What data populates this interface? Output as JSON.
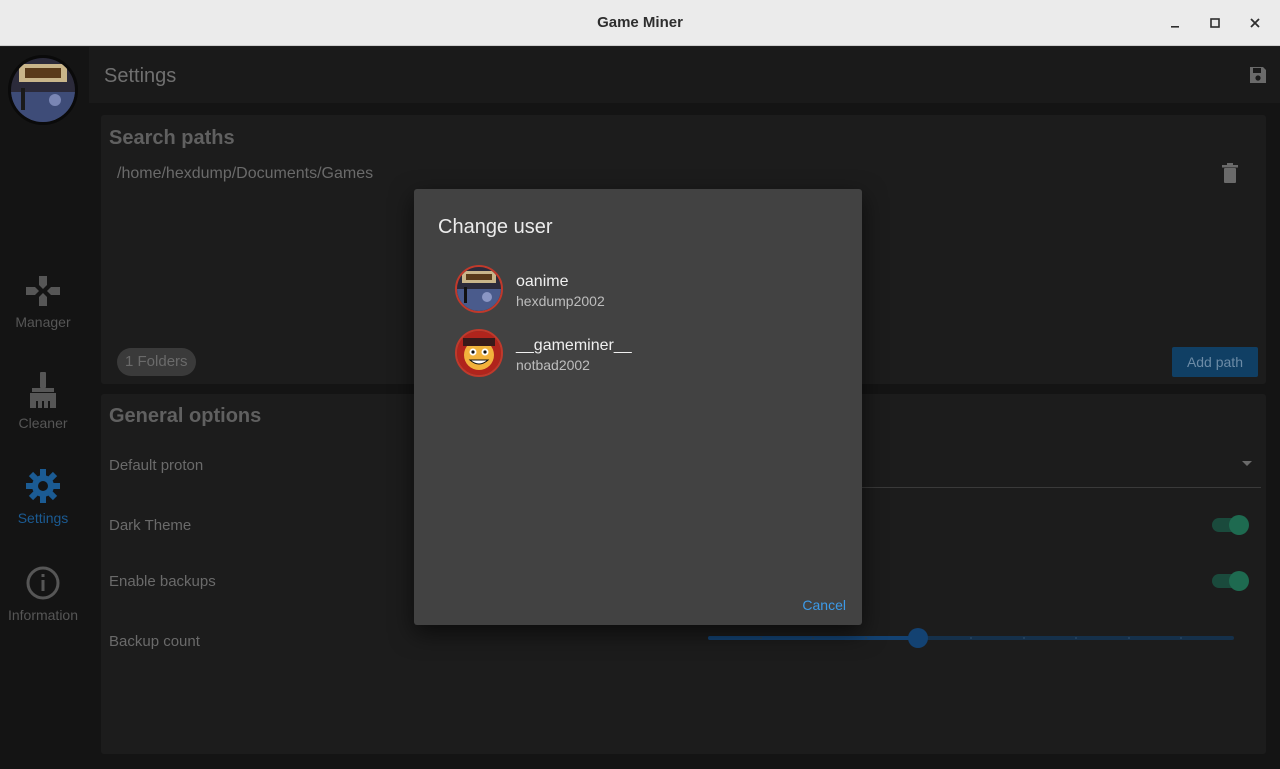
{
  "window": {
    "title": "Game Miner",
    "minimize_glyph": "–",
    "maximize_glyph": "□",
    "close_glyph": "✕"
  },
  "nav": {
    "items": [
      {
        "label": "Manager",
        "icon": "gamepad-icon"
      },
      {
        "label": "Cleaner",
        "icon": "broom-icon"
      },
      {
        "label": "Settings",
        "icon": "gear-icon"
      },
      {
        "label": "Information",
        "icon": "info-icon"
      }
    ]
  },
  "appbar": {
    "title": "Settings",
    "save_icon": "save-icon"
  },
  "search_paths": {
    "title": "Search paths",
    "paths": [
      "/home/hexdump/Documents/Games"
    ],
    "folder_count_chip": "1 Folders",
    "add_button": "Add path"
  },
  "general_options": {
    "title": "General options",
    "default_proton_label": "Default proton",
    "dark_theme_label": "Dark Theme",
    "dark_theme_on": true,
    "backups_label": "Enable backups",
    "backups_on": true,
    "backup_count_label": "Backup count",
    "backup_count_fraction": 0.4
  },
  "dialog": {
    "title": "Change user",
    "users": [
      {
        "name": "oanime",
        "sub": "hexdump2002"
      },
      {
        "name": "__gameminer__",
        "sub": "notbad2002"
      }
    ],
    "cancel": "Cancel"
  },
  "colors": {
    "accent": "#3c9ae8",
    "toggle_on": "#1e6a50",
    "dialog_bg": "#424242"
  }
}
